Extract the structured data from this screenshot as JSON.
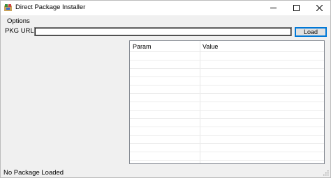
{
  "window": {
    "title": "Direct Package Installer",
    "icon": "installer-app-icon"
  },
  "menu": {
    "options_label": "Options"
  },
  "url_row": {
    "label": "PKG URL:",
    "value": "",
    "load_label": "Load"
  },
  "grid": {
    "headers": [
      "Param",
      "Value"
    ],
    "row_count": 13
  },
  "status": {
    "text": "No Package Loaded"
  },
  "colors": {
    "accent": "#0078d7",
    "window_bg": "#f0f0f0"
  }
}
